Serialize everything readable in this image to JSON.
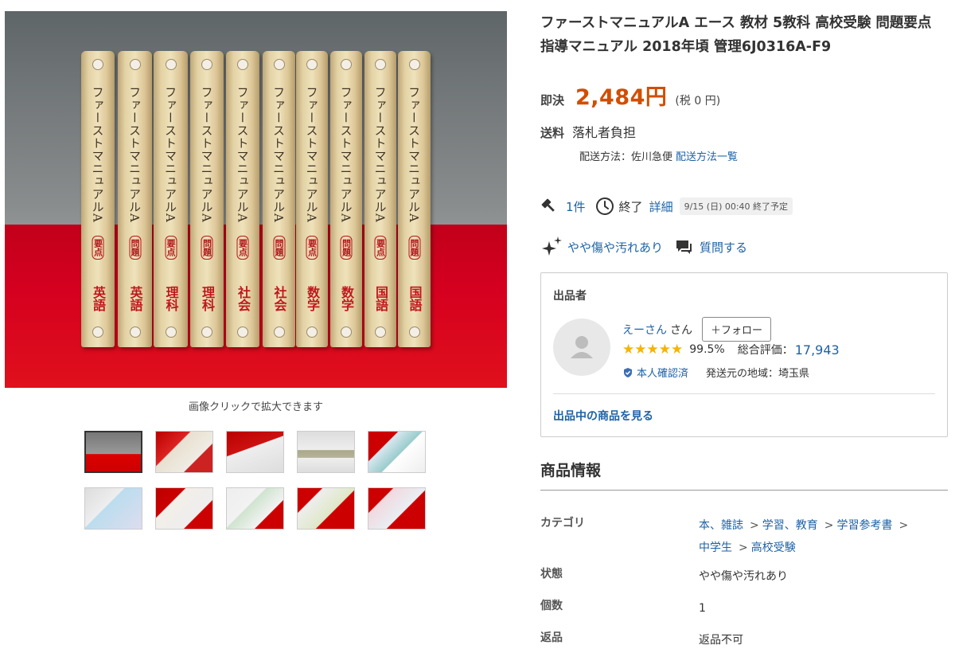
{
  "gallery": {
    "binders": [
      {
        "spine": "ファーストマニュアルA",
        "sub": "要点",
        "subject": "英語"
      },
      {
        "spine": "ファーストマニュアルA",
        "sub": "問題",
        "subject": "英語"
      },
      {
        "spine": "ファーストマニュアルA",
        "sub": "要点",
        "subject": "理科"
      },
      {
        "spine": "ファーストマニュアルA",
        "sub": "問題",
        "subject": "理科"
      },
      {
        "spine": "ファーストマニュアルA",
        "sub": "要点",
        "subject": "社会"
      },
      {
        "spine": "ファーストマニュアルA",
        "sub": "問題",
        "subject": "社会"
      },
      {
        "spine": "ファーストマニュアルA",
        "sub": "要点",
        "subject": "数学"
      },
      {
        "spine": "ファーストマニュアルA",
        "sub": "問題",
        "subject": "数学"
      },
      {
        "spine": "ファーストマニュアルA",
        "sub": "要点",
        "subject": "国語"
      },
      {
        "spine": "ファーストマニュアルA",
        "sub": "問題",
        "subject": "国語"
      }
    ],
    "caption": "画像クリックで拡大できます"
  },
  "item": {
    "title": "ファーストマニュアルA エース 教材 5教科 高校受験 問題要点 指導マニュアル 2018年頃 管理6J0316A-F9",
    "price_label": "即決",
    "price": "2,484円",
    "tax": "(税 0 円)",
    "shipping_label": "送料",
    "shipping_value": "落札者負担",
    "shipping_method_text": "配送方法：佐川急便",
    "shipping_method_link": "配送方法一覧",
    "bids": "1件",
    "status": "終了",
    "detail_link": "詳細",
    "end_time": "9/15 (日) 00:40 終了予定",
    "condition": "やや傷や汚れあり",
    "question_link": "質問する"
  },
  "seller": {
    "header": "出品者",
    "name": "えーさん",
    "honorific": "さん",
    "follow": "＋フォロー",
    "rating_pct": "99.5%",
    "total_label": "総合評価：",
    "total_value": "17,943",
    "verified": "本人確認済",
    "ship_from": "発送元の地域：埼玉県",
    "listings_link": "出品中の商品を見る",
    "stars": 5
  },
  "info": {
    "heading": "商品情報",
    "category_label": "カテゴリ",
    "categories": [
      "本、雑誌",
      "学習、教育",
      "学習参考書",
      "中学生",
      "高校受験"
    ],
    "condition_label": "状態",
    "condition_value": "やや傷や汚れあり",
    "qty_label": "個数",
    "qty_value": "1",
    "return_label": "返品",
    "return_value": "返品不可"
  },
  "colors": {
    "accent_price": "#d14e00",
    "link": "#1d62a6",
    "star": "#f5b400"
  }
}
